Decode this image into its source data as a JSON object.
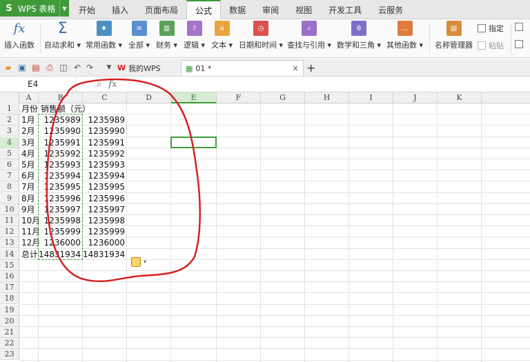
{
  "app": {
    "name": "WPS 表格",
    "logo": "S"
  },
  "ribbon_tabs": [
    "开始",
    "插入",
    "页面布局",
    "公式",
    "数据",
    "审阅",
    "视图",
    "开发工具",
    "云服务"
  ],
  "ribbon": {
    "insert_function": "插入函数",
    "autosum": "自动求和",
    "common_functions": "常用函数",
    "all": "全部",
    "finance": "财务",
    "logic": "逻辑",
    "text": "文本",
    "datetime": "日期和时间",
    "lookup": "查找与引用",
    "math": "数学和三角",
    "other": "其他函数",
    "name_manager": "名称管理器",
    "specify": "指定",
    "paste": "粘贴",
    "fx_symbol": "fx",
    "sigma": "Σ",
    "dropdown": "▾"
  },
  "doc_tabs": {
    "wps_home": "我的WPS",
    "file": "01 *",
    "close": "×",
    "new": "+"
  },
  "formula_bar": {
    "name_box": "E4",
    "fx": "fx"
  },
  "colors": {
    "accent": "#3f9a3a",
    "annotation": "#d62020"
  },
  "columns": [
    "A",
    "B",
    "C",
    "D",
    "E",
    "F",
    "G",
    "H",
    "I",
    "J",
    "K"
  ],
  "active_col": "E",
  "rows": [
    "1",
    "2",
    "3",
    "4",
    "5",
    "6",
    "7",
    "8",
    "9",
    "10",
    "11",
    "12",
    "13",
    "14",
    "15",
    "16",
    "17",
    "18",
    "19",
    "20",
    "21",
    "22",
    "23"
  ],
  "active_row": "4",
  "sheet": {
    "a": [
      "月份",
      "1月",
      "2月",
      "3月",
      "4月",
      "5月",
      "6月",
      "7月",
      "8月",
      "9月",
      "10月",
      "11月",
      "12月",
      "总计"
    ],
    "b": [
      "销售额（元）",
      "1235989",
      "1235990",
      "1235991",
      "1235992",
      "1235993",
      "1235994",
      "1235995",
      "1235996",
      "1235997",
      "1235998",
      "1235999",
      "1236000",
      "14831934"
    ],
    "c": [
      "",
      "1235989",
      "1235990",
      "1235991",
      "1235992",
      "1235993",
      "1235994",
      "1235995",
      "1235996",
      "1235997",
      "1235998",
      "1235999",
      "1236000",
      "14831934"
    ]
  }
}
